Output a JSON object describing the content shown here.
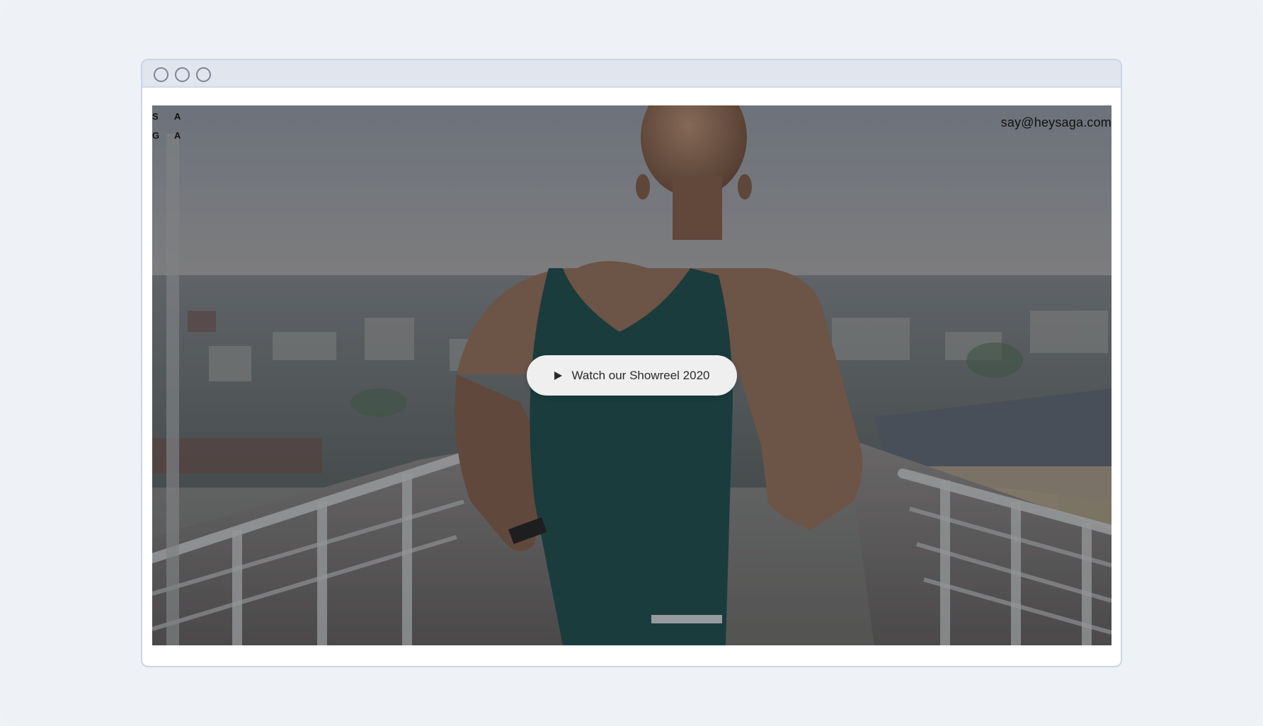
{
  "logo": {
    "letters": [
      "S",
      "A",
      "G",
      "A"
    ]
  },
  "header": {
    "email": "say@heysaga.com"
  },
  "hero": {
    "cta_label": "Watch our Showreel 2020",
    "cta_icon": "play-icon"
  },
  "window": {
    "controls": [
      "close-icon",
      "minimize-icon",
      "maximize-icon"
    ]
  },
  "colors": {
    "page_bg": "#eef2f6",
    "titlebar": "#e0e5ee",
    "button_bg": "#efefef"
  }
}
